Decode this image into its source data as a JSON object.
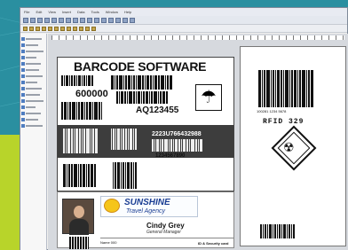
{
  "menu": {
    "items": [
      "File",
      "Edit",
      "View",
      "Insert",
      "Data",
      "Tools",
      "Window",
      "Help"
    ]
  },
  "label": {
    "title": "BARCODE SOFTWARE",
    "number_left": "600000",
    "code_right": "AQ123455",
    "band_code": "2223U766432988",
    "bottom_number": "1234567890",
    "umbrella_symbol": "umbrella"
  },
  "card": {
    "company": "SUNSHINE",
    "company_sub": "Travel Agency",
    "name": "Cindy Grey",
    "role": "General Manager",
    "footer": "ID & Security card",
    "footer_left": "Name   000"
  },
  "right_label": {
    "rfid_text": "RFID 329",
    "digits": "100281 1234 5678",
    "hazard_icon": "corrosive-hazard"
  },
  "colors": {
    "background": "#2a8fa0",
    "accent": "#b8d42a",
    "brand": "#1a3d93"
  }
}
